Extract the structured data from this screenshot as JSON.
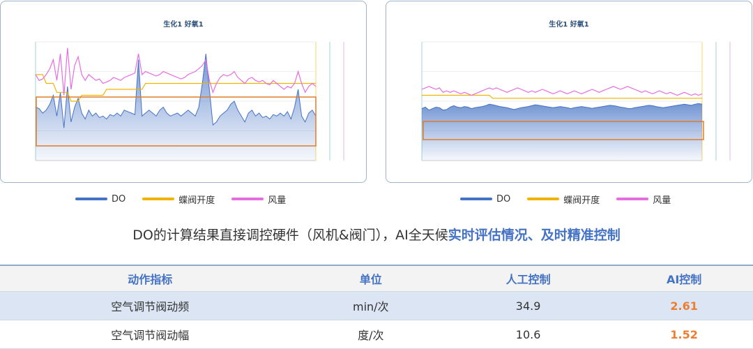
{
  "charts": [
    {
      "title": "生化1 好氧1"
    },
    {
      "title": "生化1 好氧1"
    }
  ],
  "legend": [
    {
      "label": "DO",
      "color": "#4472c4"
    },
    {
      "label": "蝶阀开度",
      "color": "#f0b400"
    },
    {
      "label": "风量",
      "color": "#e66de0"
    }
  ],
  "caption": {
    "plain": "DO的计算结果直接调控硬件（风机&阀门），AI全天候",
    "highlight": "实时评估情况、及时精准控制"
  },
  "table": {
    "headers": [
      "动作指标",
      "单位",
      "人工控制",
      "AI控制"
    ],
    "rows": [
      [
        "空气调节阀动频",
        "min/次",
        "34.9",
        "2.61"
      ],
      [
        "空气调节阀动幅",
        "度/次",
        "10.6",
        "1.52"
      ]
    ]
  },
  "colors": {
    "do": "#4472c4",
    "valve": "#f0b400",
    "air": "#e66de0",
    "box": "#e07b28",
    "accent": "#ed7d31"
  },
  "chart_data": [
    {
      "type": "line",
      "title": "生化1 好氧1",
      "series": [
        {
          "name": "DO",
          "style": "area",
          "values": [
            1.8,
            1.75,
            1.6,
            1.7,
            1.9,
            2.2,
            1.5,
            2.3,
            1.1,
            2.5,
            1.3,
            1.8,
            2.1,
            1.6,
            1.4,
            1.7,
            1.5,
            1.6,
            1.45,
            1.5,
            1.4,
            1.55,
            1.5,
            1.6,
            1.5,
            1.7,
            1.65,
            1.6,
            1.55,
            3.4,
            1.5,
            1.6,
            1.7,
            1.6,
            1.5,
            1.7,
            1.8,
            1.6,
            1.5,
            1.55,
            1.6,
            1.5,
            1.6,
            1.7,
            1.6,
            1.5,
            1.8,
            2.6,
            3.6,
            2.4,
            1.2,
            1.3,
            1.5,
            1.6,
            1.7,
            1.9,
            2.0,
            1.7,
            1.5,
            1.3,
            1.6,
            1.7,
            1.5,
            1.6,
            1.45,
            1.5,
            1.4,
            1.55,
            1.5,
            1.6,
            1.5,
            1.65,
            1.4,
            1.8,
            2.4,
            1.5,
            1.3,
            1.6,
            1.7,
            1.5
          ]
        },
        {
          "name": "蝶阀开度",
          "style": "line",
          "values": [
            2.9,
            2.9,
            2.9,
            2.6,
            2.6,
            2.6,
            2.3,
            2.3,
            2.3,
            2.3,
            2.0,
            2.0,
            2.0,
            2.2,
            2.2,
            2.2,
            2.2,
            2.2,
            2.2,
            2.2,
            2.4,
            2.4,
            2.4,
            2.4,
            2.4,
            2.4,
            2.4,
            2.4,
            2.4,
            2.4,
            2.4,
            2.6,
            2.6,
            2.6,
            2.6,
            2.6,
            2.6,
            2.6,
            2.6,
            2.6,
            2.6,
            2.6,
            2.6,
            2.6,
            2.6,
            2.6,
            2.6,
            2.6,
            2.6,
            2.6,
            2.6,
            2.6,
            2.6,
            2.6,
            2.6,
            2.6,
            2.6,
            2.6,
            2.6,
            2.6,
            2.6,
            2.6,
            2.6,
            2.6,
            2.6,
            2.6,
            2.6,
            2.6,
            2.6,
            2.6,
            2.6,
            2.6,
            2.6,
            2.6,
            2.6,
            2.6,
            2.6,
            2.6,
            2.6,
            2.6
          ]
        },
        {
          "name": "风量",
          "style": "line",
          "values": [
            2.9,
            2.7,
            2.75,
            2.9,
            3.1,
            3.4,
            2.7,
            3.6,
            2.2,
            3.8,
            2.4,
            3.2,
            3.5,
            2.9,
            2.7,
            2.9,
            2.8,
            2.7,
            2.75,
            2.6,
            2.65,
            2.7,
            2.8,
            2.75,
            2.7,
            2.8,
            2.85,
            2.9,
            2.95,
            3.6,
            2.9,
            3.0,
            2.95,
            2.9,
            2.85,
            2.9,
            3.0,
            2.95,
            2.9,
            2.85,
            2.8,
            2.75,
            2.8,
            2.9,
            2.95,
            3.0,
            3.1,
            3.2,
            3.4,
            2.7,
            2.3,
            2.6,
            2.8,
            2.9,
            2.85,
            2.9,
            3.0,
            2.8,
            2.7,
            2.6,
            2.75,
            2.8,
            2.7,
            2.65,
            2.7,
            2.6,
            2.55,
            2.7,
            2.6,
            2.5,
            2.4,
            2.5,
            2.45,
            2.6,
            3.0,
            2.6,
            2.3,
            2.5,
            2.6,
            2.5
          ]
        }
      ]
    },
    {
      "type": "line",
      "title": "生化1 好氧1",
      "series": [
        {
          "name": "DO",
          "style": "area",
          "values": [
            1.75,
            1.8,
            1.7,
            1.75,
            1.8,
            1.78,
            1.7,
            1.72,
            1.8,
            1.85,
            1.8,
            1.78,
            1.82,
            1.8,
            1.75,
            1.78,
            1.8,
            1.82,
            1.85,
            1.9,
            1.88,
            1.85,
            1.82,
            1.8,
            1.78,
            1.75,
            1.72,
            1.75,
            1.78,
            1.8,
            1.82,
            1.85,
            1.88,
            1.86,
            1.84,
            1.82,
            1.8,
            1.78,
            1.8,
            1.82,
            1.8,
            1.78,
            1.75,
            1.78,
            1.8,
            1.82,
            1.8,
            1.78,
            1.76,
            1.78,
            1.8,
            1.82,
            1.84,
            1.86,
            1.85,
            1.83,
            1.8,
            1.78,
            1.76,
            1.75,
            1.78,
            1.8,
            1.82,
            1.84,
            1.86,
            1.85,
            1.82,
            1.8,
            1.78,
            1.8,
            1.82,
            1.84,
            1.86,
            1.88,
            1.9,
            1.88,
            1.86,
            1.9,
            1.92,
            1.9
          ]
        },
        {
          "name": "蝶阀开度",
          "style": "line",
          "values": [
            2.2,
            2.2,
            2.2,
            2.2,
            2.2,
            2.2,
            2.2,
            2.2,
            2.2,
            2.2,
            2.2,
            2.2,
            2.2,
            2.2,
            2.2,
            2.2,
            2.2,
            2.2,
            2.2,
            2.2,
            2.1,
            2.1,
            2.1,
            2.1,
            2.1,
            2.1,
            2.1,
            2.1,
            2.1,
            2.1,
            2.1,
            2.1,
            2.1,
            2.1,
            2.1,
            2.1,
            2.1,
            2.1,
            2.1,
            2.1,
            2.1,
            2.1,
            2.1,
            2.1,
            2.1,
            2.1,
            2.1,
            2.1,
            2.1,
            2.1,
            2.1,
            2.1,
            2.1,
            2.1,
            2.1,
            2.1,
            2.1,
            2.1,
            2.1,
            2.1,
            2.1,
            2.1,
            2.1,
            2.1,
            2.1,
            2.1,
            2.1,
            2.1,
            2.1,
            2.1,
            2.1,
            2.1,
            2.1,
            2.1,
            2.1,
            2.1,
            2.1,
            2.1,
            2.1,
            2.1
          ]
        },
        {
          "name": "风量",
          "style": "line",
          "values": [
            2.4,
            2.45,
            2.5,
            2.45,
            2.4,
            2.45,
            2.3,
            2.35,
            2.3,
            2.35,
            2.3,
            2.25,
            2.3,
            2.25,
            2.2,
            2.25,
            2.3,
            2.35,
            2.4,
            2.45,
            2.4,
            2.45,
            2.4,
            2.35,
            2.3,
            2.35,
            2.4,
            2.45,
            2.4,
            2.35,
            2.3,
            2.35,
            2.3,
            2.35,
            2.4,
            2.35,
            2.3,
            2.25,
            2.3,
            2.35,
            2.3,
            2.25,
            2.3,
            2.35,
            2.3,
            2.25,
            2.3,
            2.35,
            2.4,
            2.35,
            2.3,
            2.35,
            2.4,
            2.45,
            2.5,
            2.45,
            2.4,
            2.45,
            2.5,
            2.45,
            2.4,
            2.35,
            2.3,
            2.35,
            2.3,
            2.25,
            2.3,
            2.35,
            2.3,
            2.25,
            2.3,
            2.25,
            2.2,
            2.25,
            2.3,
            2.25,
            2.2,
            2.25,
            2.2,
            2.25
          ]
        }
      ]
    }
  ]
}
